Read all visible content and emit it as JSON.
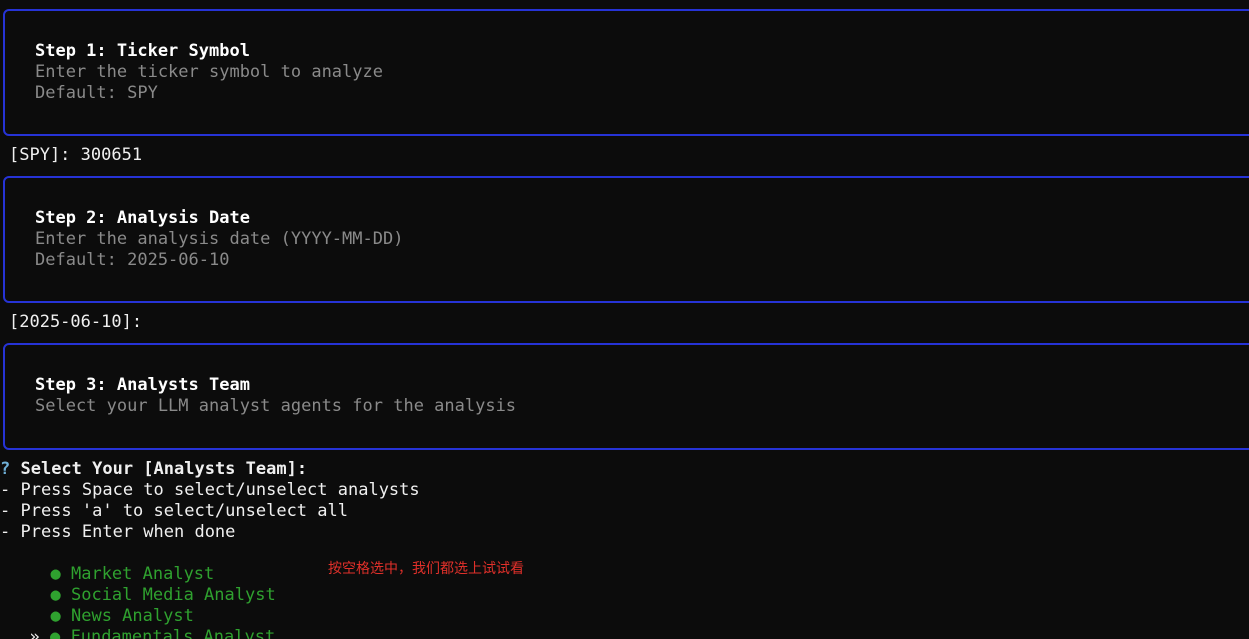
{
  "step1": {
    "title": "Step 1: Ticker Symbol",
    "desc": "Enter the ticker symbol to analyze",
    "default": "Default: SPY"
  },
  "step1_prompt": "[SPY]: 300651",
  "step2": {
    "title": "Step 2: Analysis Date",
    "desc": "Enter the analysis date (YYYY-MM-DD)",
    "default": "Default: 2025-06-10"
  },
  "step2_prompt": "[2025-06-10]:",
  "step3": {
    "title": "Step 3: Analysts Team",
    "desc": "Select your LLM analyst agents for the analysis"
  },
  "select": {
    "qmark": "?",
    "question": " Select Your [Analysts Team]:",
    "instructions": [
      "- Press Space to select/unselect analysts",
      "- Press 'a' to select/unselect all",
      "- Press Enter when done"
    ],
    "bullet": "●",
    "pointer": "»",
    "options": [
      "Market Analyst",
      "Social Media Analyst",
      "News Analyst",
      "Fundamentals Analyst"
    ]
  },
  "annotation": "按空格选中，我们都选上试试看",
  "colors": {
    "border": "#2633d6",
    "selected": "#2fa12f",
    "annotation": "#e0302a"
  }
}
